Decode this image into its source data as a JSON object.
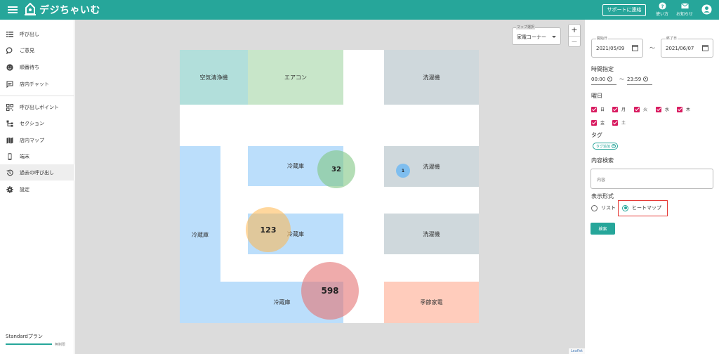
{
  "app": {
    "name": "デジちゃいむ"
  },
  "topbar": {
    "support_label": "サポートに連絡",
    "help_label": "使い方",
    "notify_label": "お知らせ"
  },
  "sidebar": {
    "items": [
      {
        "label": "呼び出し",
        "icon": "list-icon"
      },
      {
        "label": "ご意見",
        "icon": "chat-bubble-icon"
      },
      {
        "label": "順番待ち",
        "icon": "face-icon"
      },
      {
        "label": "店内チャット",
        "icon": "message-icon"
      },
      {
        "label": "呼び出しポイント",
        "icon": "qr-code-icon"
      },
      {
        "label": "セクション",
        "icon": "hierarchy-icon"
      },
      {
        "label": "店内マップ",
        "icon": "map-icon"
      },
      {
        "label": "端末",
        "icon": "smartphone-icon"
      },
      {
        "label": "過去の呼び出し",
        "icon": "history-icon",
        "active": true
      },
      {
        "label": "設定",
        "icon": "gear-icon"
      }
    ],
    "plan_label": "Standardプラン",
    "plan_sub": "無制限"
  },
  "map": {
    "select_label": "マップ選択",
    "select_value": "家電コーナー",
    "zoom_in": "+",
    "zoom_out": "−",
    "attribution": "Leaflet",
    "zones": [
      {
        "label": "空気清浄機",
        "color": "#b2dfdb"
      },
      {
        "label": "エアコン",
        "color": "#c8e6c9"
      },
      {
        "label": "洗濯機",
        "color": "#cfd8dc"
      },
      {
        "label": "冷蔵庫",
        "color": "#bbdefb"
      },
      {
        "label": "洗濯機",
        "color": "#cfd8dc"
      },
      {
        "label": "冷蔵庫",
        "color": "#bbdefb"
      },
      {
        "label": "冷蔵庫",
        "color": "#bbdefb"
      },
      {
        "label": "洗濯機",
        "color": "#cfd8dc"
      },
      {
        "label": "冷蔵庫",
        "color": "#bbdefb"
      },
      {
        "label": "季節家電",
        "color": "#ffccbc"
      }
    ],
    "heat": [
      {
        "value": "32",
        "color": "#81c784"
      },
      {
        "value": "1",
        "color": "#64b5f6"
      },
      {
        "value": "123",
        "color": "#ffb74d"
      },
      {
        "value": "598",
        "color": "#e57373"
      }
    ]
  },
  "filters": {
    "start_label": "開始日",
    "start_value": "2021/05/09",
    "end_label": "終了日",
    "end_value": "2021/06/07",
    "range_sep": "〜",
    "time_title": "時間指定",
    "time_start": "00:00",
    "time_end": "23:59",
    "weekday_title": "曜日",
    "weekdays": [
      "日",
      "月",
      "火",
      "水",
      "木",
      "金",
      "土"
    ],
    "tag_title": "タグ",
    "tag_add": "タグ追加",
    "content_title": "内容検索",
    "content_placeholder": "内容",
    "format_title": "表示形式",
    "format_list": "リスト",
    "format_heatmap": "ヒートマップ",
    "search_button": "検索"
  }
}
